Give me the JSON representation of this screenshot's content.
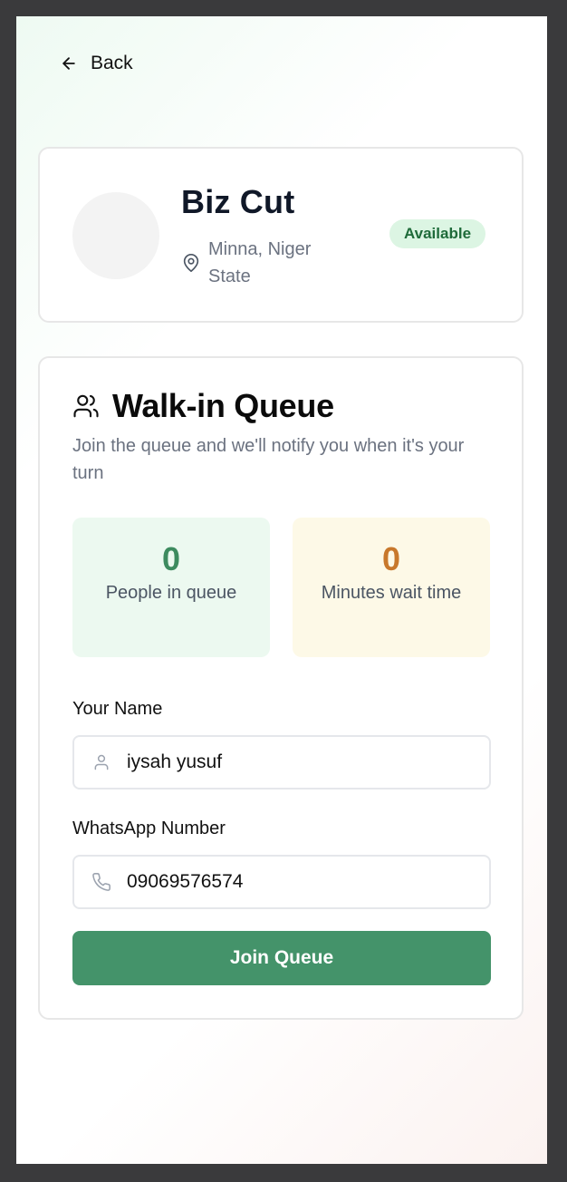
{
  "nav": {
    "back_label": "Back",
    "back_icon": "arrow-left-icon"
  },
  "shop": {
    "name": "Biz Cut",
    "location": "Minna, Niger State",
    "location_icon": "map-pin-icon",
    "status": "Available"
  },
  "queue": {
    "title": "Walk-in Queue",
    "title_icon": "users-icon",
    "subtitle": "Join the queue and we'll notify you when it's your turn",
    "people_count": "0",
    "people_label": "People in queue",
    "wait_minutes": "0",
    "wait_label": "Minutes wait time"
  },
  "form": {
    "name_label": "Your Name",
    "name_value": "iysah yusuf",
    "name_icon": "user-icon",
    "phone_label": "WhatsApp Number",
    "phone_value": "09069576574",
    "phone_icon": "phone-icon",
    "submit_label": "Join Queue"
  },
  "colors": {
    "accent": "#44936a",
    "badge_bg": "#dcf5e3",
    "badge_text": "#1f6b3a",
    "wait_number": "#c8782b"
  }
}
